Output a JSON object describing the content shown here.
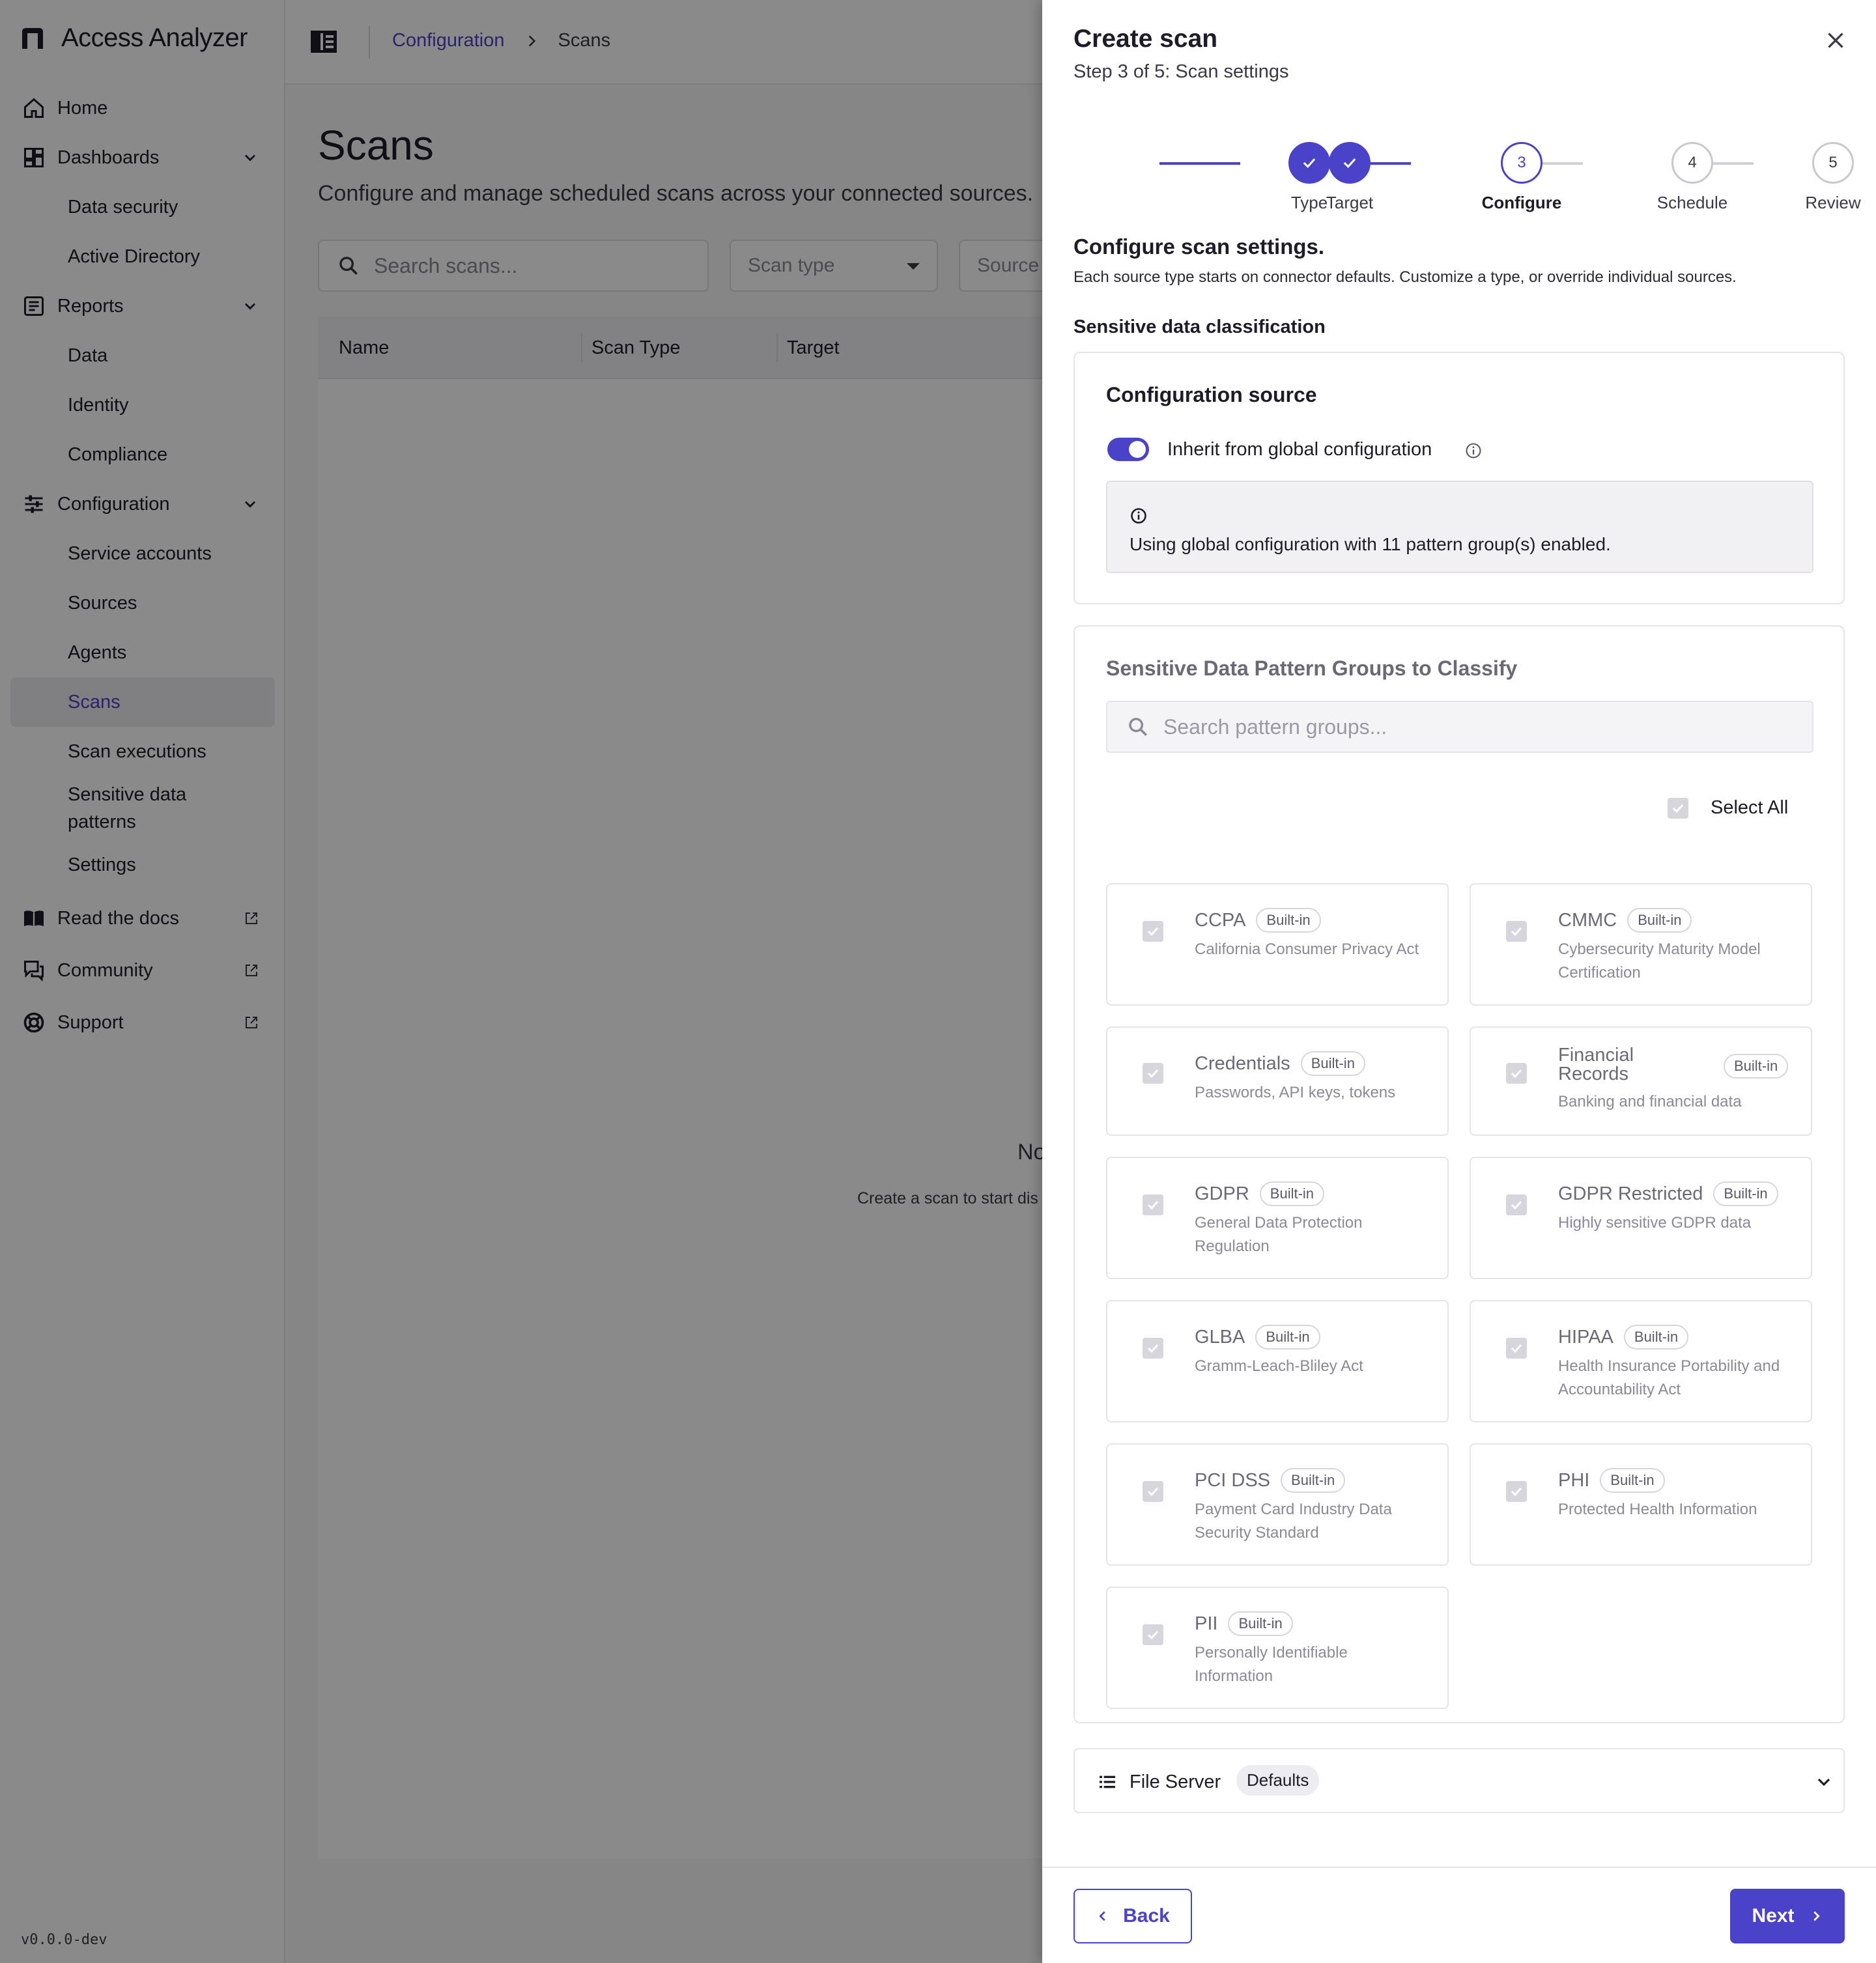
{
  "app": {
    "name": "Access Analyzer",
    "version": "v0.0.0-dev"
  },
  "sidebar": {
    "home": "Home",
    "dashboards": {
      "label": "Dashboards",
      "items": [
        "Data security",
        "Active Directory"
      ]
    },
    "reports": {
      "label": "Reports",
      "items": [
        "Data",
        "Identity",
        "Compliance"
      ]
    },
    "configuration": {
      "label": "Configuration",
      "items": [
        "Service accounts",
        "Sources",
        "Agents",
        "Scans",
        "Scan executions",
        "Sensitive data patterns",
        "Settings"
      ],
      "active": "Scans"
    },
    "links": [
      "Read the docs",
      "Community",
      "Support"
    ]
  },
  "breadcrumb": {
    "parent": "Configuration",
    "current": "Scans"
  },
  "page": {
    "title": "Scans",
    "subtitle": "Configure and manage scheduled scans across your connected sources.",
    "search_placeholder": "Search scans...",
    "filter_scan_type": "Scan type",
    "filter_source": "Source",
    "columns": [
      "Name",
      "Scan Type",
      "Target"
    ],
    "empty_title": "No",
    "empty_sub": "Create a scan to start dis"
  },
  "drawer": {
    "title": "Create scan",
    "step_text": "Step 3 of 5: Scan settings",
    "steps": [
      {
        "label": "Type",
        "num": "1",
        "state": "done"
      },
      {
        "label": "Target",
        "num": "2",
        "state": "done"
      },
      {
        "label": "Configure",
        "num": "3",
        "state": "current"
      },
      {
        "label": "Schedule",
        "num": "4",
        "state": "todo"
      },
      {
        "label": "Review",
        "num": "5",
        "state": "todo"
      }
    ],
    "heading": "Configure scan settings.",
    "description": "Each source type starts on connector defaults. Customize a type, or override individual sources.",
    "section_label": "Sensitive data classification",
    "config_source": {
      "title": "Configuration source",
      "toggle_label": "Inherit from global configuration",
      "toggle_on": true,
      "info_text": "Using global configuration with 11 pattern group(s) enabled."
    },
    "pattern_groups": {
      "title": "Sensitive Data Pattern Groups to Classify",
      "search_placeholder": "Search pattern groups...",
      "select_all": "Select All",
      "badge": "Built-in",
      "items": [
        {
          "name": "CCPA",
          "desc": "California Consumer Privacy Act"
        },
        {
          "name": "CMMC",
          "desc": "Cybersecurity Maturity Model Certification"
        },
        {
          "name": "Credentials",
          "desc": "Passwords, API keys, tokens"
        },
        {
          "name": "Financial Records",
          "desc": "Banking and financial data"
        },
        {
          "name": "GDPR",
          "desc": "General Data Protection Regulation"
        },
        {
          "name": "GDPR Restricted",
          "desc": "Highly sensitive GDPR data"
        },
        {
          "name": "GLBA",
          "desc": "Gramm-Leach-Bliley Act"
        },
        {
          "name": "HIPAA",
          "desc": "Health Insurance Portability and Accountability Act"
        },
        {
          "name": "PCI DSS",
          "desc": "Payment Card Industry Data Security Standard"
        },
        {
          "name": "PHI",
          "desc": "Protected Health Information"
        },
        {
          "name": "PII",
          "desc": "Personally Identifiable Information"
        }
      ]
    },
    "file_server": {
      "label": "File Server",
      "chip": "Defaults"
    },
    "back_label": "Back",
    "next_label": "Next"
  },
  "colors": {
    "accent": "#4a42c8",
    "scrim": "rgba(0,0,0,0.46)"
  }
}
